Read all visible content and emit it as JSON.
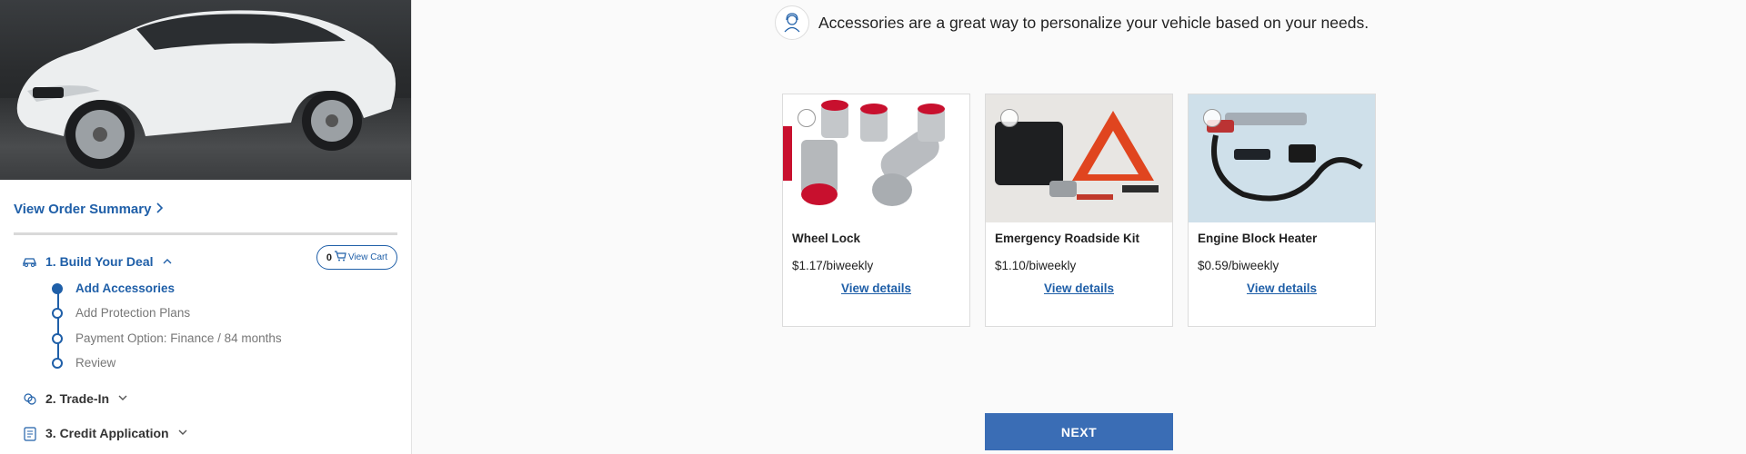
{
  "sidebar": {
    "order_summary_label": "View Order Summary",
    "view_cart": {
      "count": "0",
      "label": "View Cart"
    },
    "steps": [
      {
        "label": "1. Build Your Deal",
        "expanded": true
      },
      {
        "label": "2. Trade-In",
        "expanded": false
      },
      {
        "label": "3. Credit Application",
        "expanded": false
      }
    ],
    "substeps": [
      {
        "label": "Add Accessories",
        "current": true
      },
      {
        "label": "Add Protection Plans",
        "current": false
      },
      {
        "label": "Payment Option: Finance / 84 months",
        "current": false
      },
      {
        "label": "Review",
        "current": false
      }
    ]
  },
  "main": {
    "intro_text": "Accessories are a great way to personalize your vehicle based on your needs.",
    "accessories": [
      {
        "name": "Wheel Lock",
        "price": "$1.17/biweekly",
        "details_label": "View details"
      },
      {
        "name": "Emergency Roadside Kit",
        "price": "$1.10/biweekly",
        "details_label": "View details"
      },
      {
        "name": "Engine Block Heater",
        "price": "$0.59/biweekly",
        "details_label": "View details"
      }
    ],
    "next_label": "NEXT"
  },
  "colors": {
    "accent": "#1f5fa8",
    "button": "#3a6db5"
  }
}
